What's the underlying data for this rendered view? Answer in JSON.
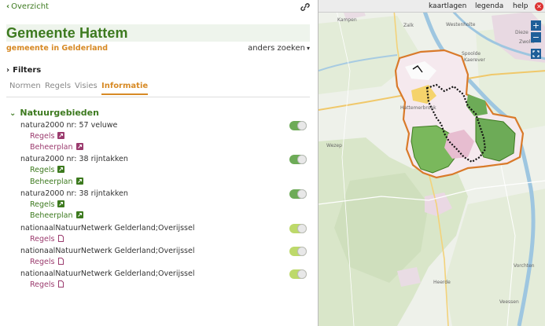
{
  "nav": {
    "back_label": "Overzicht",
    "link_icon": "link-icon"
  },
  "header": {
    "title": "Gemeente Hattem",
    "subtitle": "gemeente in Gelderland",
    "search_other": "anders zoeken"
  },
  "filters_label": "Filters",
  "tabs": [
    {
      "label": "Normen",
      "active": false
    },
    {
      "label": "Regels",
      "active": false
    },
    {
      "label": "Visies",
      "active": false
    },
    {
      "label": "Informatie",
      "active": true
    }
  ],
  "section": {
    "title": "Natuurgebieden",
    "items": [
      {
        "label": "natura2000 nr: 57 veluwe",
        "toggle": "on",
        "links": [
          {
            "label": "Regels",
            "icon": "external-link-icon"
          },
          {
            "label": "Beheerplan",
            "icon": "external-link-icon"
          }
        ]
      },
      {
        "label": "natura2000 nr: 38 rijntakken",
        "toggle": "on",
        "links": [
          {
            "label": "Regels",
            "icon": "external-link-icon"
          },
          {
            "label": "Beheerplan",
            "icon": "external-link-icon"
          }
        ]
      },
      {
        "label": "natura2000 nr: 38 rijntakken",
        "toggle": "on",
        "links": [
          {
            "label": "Regels",
            "icon": "external-link-icon"
          },
          {
            "label": "Beheerplan",
            "icon": "external-link-icon"
          }
        ]
      },
      {
        "label": "nationaalNatuurNetwerk Gelderland;Overijssel",
        "toggle": "on",
        "links": [
          {
            "label": "Regels",
            "icon": "document-icon"
          }
        ]
      },
      {
        "label": "nationaalNatuurNetwerk Gelderland;Overijssel",
        "toggle": "on",
        "links": [
          {
            "label": "Regels",
            "icon": "document-icon"
          }
        ]
      },
      {
        "label": "nationaalNatuurNetwerk Gelderland;Overijssel",
        "toggle": "on",
        "links": [
          {
            "label": "Regels",
            "icon": "document-icon"
          }
        ]
      }
    ]
  },
  "map": {
    "menu": {
      "layers": "kaartlagen",
      "legend": "legenda",
      "help": "help"
    },
    "zoom_in": "+",
    "zoom_out": "−",
    "labels": [
      "Wezep",
      "Hattemerbroek",
      "Zwolle",
      "Westenholte",
      "Spoolde",
      "Kaerever",
      "Dieze",
      "Heerde",
      "Veessen",
      "Zalk",
      "Vorchten",
      "Kampen"
    ]
  },
  "colors": {
    "brand_green": "#3d7a1f",
    "accent_orange": "#d78a25",
    "link_purple": "#9b3b6e",
    "toggle_green": "#6dab57",
    "toggle_light": "#bdd96a"
  }
}
